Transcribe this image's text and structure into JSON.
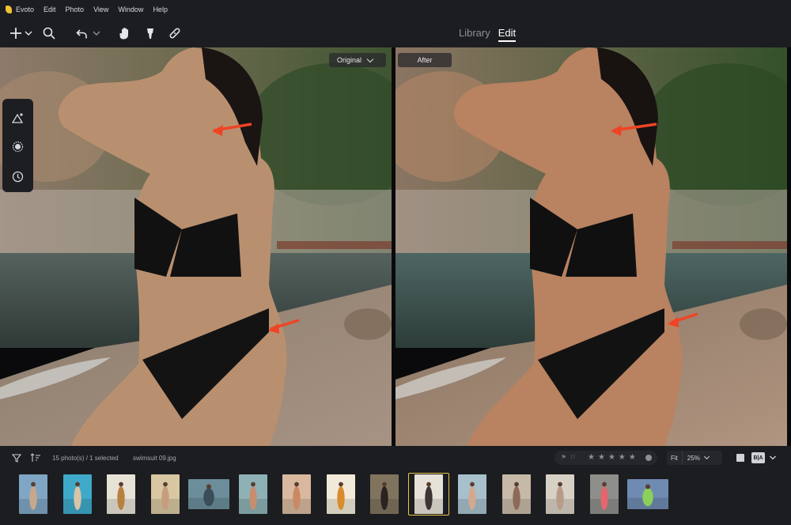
{
  "app": {
    "name": "Evoto",
    "menu": [
      "Edit",
      "Photo",
      "View",
      "Window",
      "Help"
    ]
  },
  "toolbar": {
    "icons": [
      "add-icon",
      "search-icon",
      "undo-icon",
      "hand-icon",
      "brush-icon",
      "bandage-icon"
    ],
    "tabs": [
      {
        "label": "Library",
        "active": false
      },
      {
        "label": "Edit",
        "active": true
      }
    ]
  },
  "viewer": {
    "before_label": "Original",
    "after_label": "After",
    "side_tools": [
      "triangle-adjust-icon",
      "circle-select-icon",
      "history-icon"
    ]
  },
  "status": {
    "count_text": "15 photo(s) / 1 selected",
    "filename": "swimsuit 09.jpg",
    "rating_stars": 5,
    "fit_label": "Fit",
    "zoom_label": "25%",
    "ba_label": "B|A"
  },
  "filmstrip": {
    "selected_index": 9,
    "thumbs": [
      {
        "bg": "#7fa6c4",
        "fg": "#c8a88c"
      },
      {
        "bg": "#3fa9c9",
        "fg": "#d8c4a8"
      },
      {
        "bg": "#e7e2d6",
        "fg": "#b8813f"
      },
      {
        "bg": "#d8c7a2",
        "fg": "#c79d7d"
      },
      {
        "bg": "#6b8e9a",
        "fg": "#3a4e5a"
      },
      {
        "bg": "#8db1b5",
        "fg": "#c68e6e"
      },
      {
        "bg": "#d8b9a0",
        "fg": "#c98964"
      },
      {
        "bg": "#f1ead8",
        "fg": "#d98b2e"
      },
      {
        "bg": "#80745f",
        "fg": "#2a2320"
      },
      {
        "bg": "#e6e2d9",
        "fg": "#3c3533"
      },
      {
        "bg": "#a7c0cc",
        "fg": "#d2a98f"
      },
      {
        "bg": "#c7b9a8",
        "fg": "#8c6a5a"
      },
      {
        "bg": "#d7d0c5",
        "fg": "#b89b8a"
      },
      {
        "bg": "#8e8e8a",
        "fg": "#e4666e"
      },
      {
        "bg": "#6f8bb2",
        "fg": "#8ad05a"
      }
    ]
  }
}
